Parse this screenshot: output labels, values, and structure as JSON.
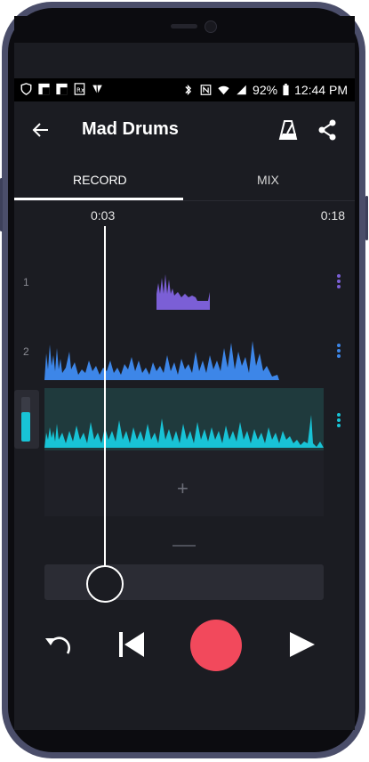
{
  "status": {
    "battery": "92%",
    "time": "12:44 PM"
  },
  "appbar": {
    "title": "Mad Drums"
  },
  "tabs": [
    {
      "label": "RECORD",
      "active": true
    },
    {
      "label": "MIX",
      "active": false
    }
  ],
  "timeline": {
    "current": "0:03",
    "total": "0:18"
  },
  "tracks": [
    {
      "number": "1",
      "color": "#7b5fd6"
    },
    {
      "number": "2",
      "color": "#3d86e8"
    },
    {
      "number": "",
      "color": "#18c3d6",
      "selected": true
    }
  ],
  "add_track_label": "+",
  "colors": {
    "record": "#f2495c",
    "accent": "#18c3d6",
    "background": "#1b1c22"
  },
  "icons": [
    "back-arrow-icon",
    "metronome-icon",
    "share-icon",
    "undo-icon",
    "skip-back-icon",
    "record-icon",
    "play-icon"
  ]
}
